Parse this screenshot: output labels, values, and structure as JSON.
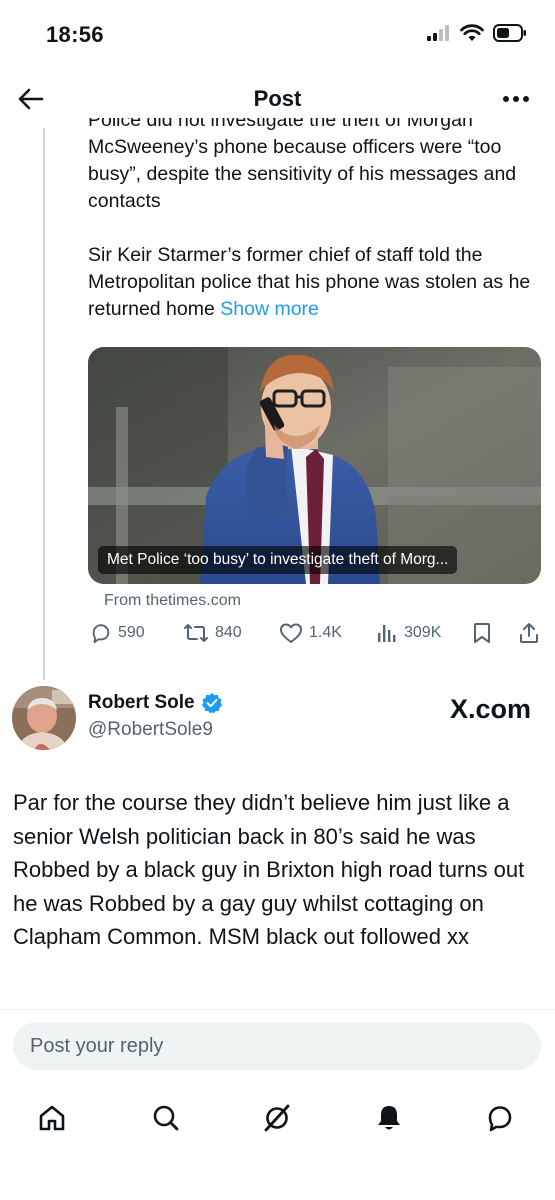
{
  "status_bar": {
    "time": "18:56"
  },
  "header": {
    "title": "Post"
  },
  "tweet": {
    "cut_line": "Police did not investigate the theft of Morgan",
    "para1": "McSweeney’s phone because officers were “too busy”, despite the sensitivity of his messages and contacts",
    "para2": "Sir Keir Starmer’s former chief of staff told the Metropolitan police that his phone was stolen as he returned home",
    "show_more": "Show more",
    "card": {
      "caption": "Met Police ‘too busy’ to investigate theft of Morg...",
      "source": "From thetimes.com"
    },
    "stats": {
      "replies": "590",
      "reposts": "840",
      "likes": "1.4K",
      "views": "309K"
    }
  },
  "reply": {
    "name": "Robert Sole",
    "handle": "@RobertSole9",
    "watermark": "X.com",
    "text": "Par for the course they didn’t believe him just like a senior Welsh politician back in 80’s said he was Robbed by a black guy in Brixton high road turns out he was Robbed by a gay guy whilst cottaging on Clapham Common. MSM black out followed xx"
  },
  "composer": {
    "placeholder": "Post your reply"
  },
  "colors": {
    "link": "#1d9bf0",
    "muted": "#536471",
    "verified": "#1d9bf0"
  }
}
